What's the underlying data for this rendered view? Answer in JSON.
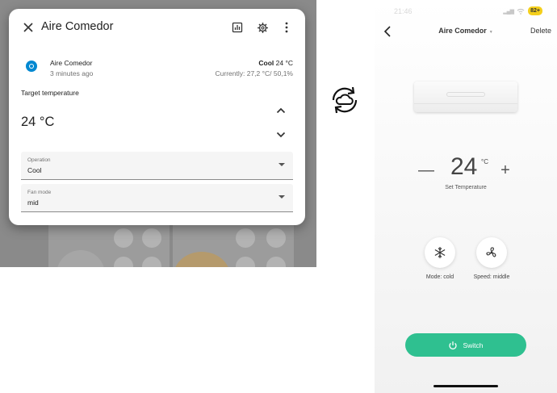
{
  "colors": {
    "ha_accent": "#0288d1",
    "switch_green": "#2fc090",
    "battery_yellow": "#f4cf1b",
    "dim_overlay": "#8a8a8a"
  },
  "ha_dialog": {
    "title": "Aire Comedor",
    "close_icon": "close-icon",
    "history_icon": "chart-icon",
    "settings_icon": "gear-icon",
    "more_icon": "more-vertical-icon",
    "entity_name": "Aire Comedor",
    "last_changed": "3 minutes ago",
    "mode": "Cool",
    "target_short": "24 °C",
    "current": "Currently: 27,2 °C/ 50,1%",
    "target_label": "Target temperature",
    "target_value": "24 °C",
    "operation": {
      "label": "Operation",
      "value": "Cool"
    },
    "fan_mode": {
      "label": "Fan mode",
      "value": "mid"
    }
  },
  "sync_icon": "cloud-sync-icon",
  "phone": {
    "status_time": "21:46",
    "battery": "82+",
    "device_title": "Aire Comedor",
    "delete_label": "Delete",
    "minus": "—",
    "plus": "+",
    "temperature": "24",
    "temperature_unit": "°C",
    "temperature_label": "Set Temperature",
    "mode_label": "Mode: cold",
    "speed_label": "Speed: middle",
    "switch_label": "Switch"
  }
}
